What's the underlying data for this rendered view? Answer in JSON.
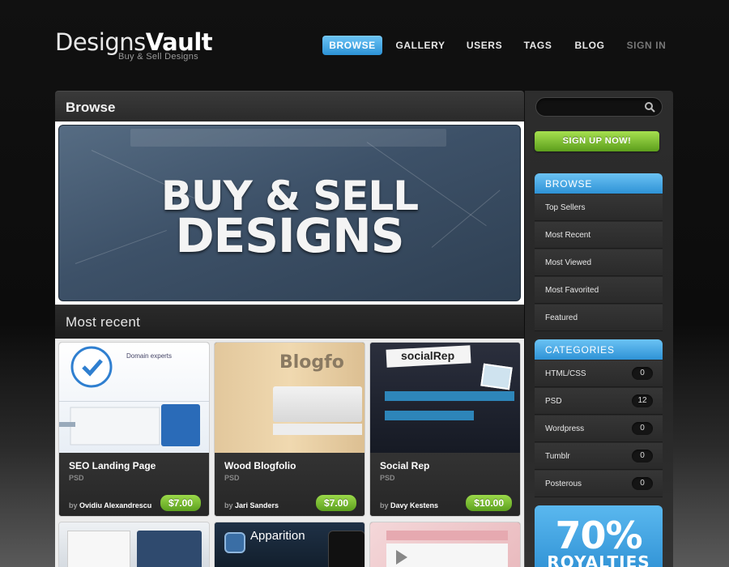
{
  "logo": {
    "part1": "Designs",
    "part2": "Vault",
    "tagline": "Buy & Sell Designs"
  },
  "nav": [
    {
      "label": "BROWSE",
      "active": true
    },
    {
      "label": "GALLERY"
    },
    {
      "label": "USERS"
    },
    {
      "label": "TAGS"
    },
    {
      "label": "BLOG"
    },
    {
      "label": "SIGN IN"
    }
  ],
  "main": {
    "title": "Browse",
    "banner": {
      "line1": "BUY & SELL",
      "line2": "DESIGNS"
    },
    "recent_title": "Most recent",
    "items": [
      {
        "name": "SEO Landing Page",
        "type": "PSD",
        "by": "by",
        "author": "Ovidiu Alexandrescu",
        "price": "$7.00",
        "thumb_text": "Domain experts"
      },
      {
        "name": "Wood Blogfolio",
        "type": "PSD",
        "by": "by",
        "author": "Jari Sanders",
        "price": "$7.00",
        "thumb_text": "Blogfo"
      },
      {
        "name": "Social Rep",
        "type": "PSD",
        "by": "by",
        "author": "Davy Kestens",
        "price": "$10.00",
        "thumb_text": "socialRep"
      }
    ],
    "more_items": [
      {
        "thumb_text": ""
      },
      {
        "thumb_text": "Apparition"
      },
      {
        "thumb_text": ""
      }
    ]
  },
  "sidebar": {
    "search_placeholder": "",
    "signup_label": "SIGN UP NOW!",
    "browse": {
      "title": "BROWSE",
      "items": [
        "Top Sellers",
        "Most Recent",
        "Most Viewed",
        "Most Favorited",
        "Featured"
      ]
    },
    "categories": {
      "title": "CATEGORIES",
      "items": [
        {
          "label": "HTML/CSS",
          "count": "0"
        },
        {
          "label": "PSD",
          "count": "12"
        },
        {
          "label": "Wordpress",
          "count": "0"
        },
        {
          "label": "Tumblr",
          "count": "0"
        },
        {
          "label": "Posterous",
          "count": "0"
        }
      ]
    },
    "promo": {
      "big": "70%",
      "sub": "ROYALTIES"
    }
  },
  "colors": {
    "accent_blue": "#2e92d6",
    "accent_green": "#5c9e1c",
    "background": "#0c0c0c"
  }
}
